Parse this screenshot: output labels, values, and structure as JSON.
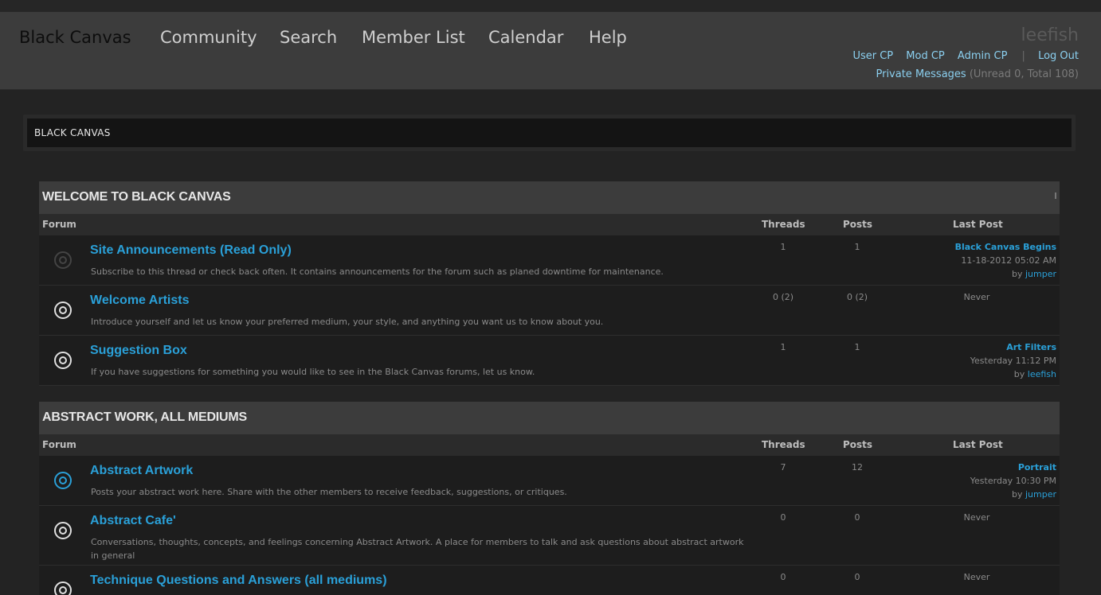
{
  "header": {
    "brand": "Black Canvas",
    "nav": [
      "Community",
      "Search",
      "Member List",
      "Calendar",
      "Help"
    ],
    "username": "leefish",
    "user_links": [
      "User CP",
      "Mod CP",
      "Admin CP",
      "Log Out"
    ],
    "pm_label": "Private Messages",
    "pm_count": "(Unread 0, Total 108)"
  },
  "breadcrumb": "BLACK CANVAS",
  "columns": {
    "forum": "Forum",
    "threads": "Threads",
    "posts": "Posts",
    "last_post": "Last Post"
  },
  "colors": {
    "accent": "#2aa0d8",
    "header_bg": "#3c3c3c",
    "row_bg": "#1d1d1d"
  },
  "categories": [
    {
      "title": "WELCOME TO BLACK CANVAS",
      "forums": [
        {
          "title": "Site Announcements (Read Only)",
          "desc": "Subscribe to this thread or check back often. It contains announcements for the forum such as planed downtime for maintenance.",
          "threads": "1",
          "posts": "1",
          "lp_title": "Black Canvas Begins",
          "lp_date": "11-18-2012 05:02 AM",
          "lp_by": "by",
          "lp_user": "jumper",
          "icon": "forum-off-icon"
        },
        {
          "title": "Welcome Artists",
          "desc": "Introduce yourself and let us know your preferred medium, your style, and anything you want us to know about you.",
          "threads": "0 (2)",
          "posts": "0 (2)",
          "never": "Never",
          "icon": "forum-read-icon"
        },
        {
          "title": "Suggestion Box",
          "desc": "If you have suggestions for something you would like to see in the Black Canvas forums, let us know.",
          "threads": "1",
          "posts": "1",
          "lp_title": "Art Filters",
          "lp_date": "Yesterday 11:12 PM",
          "lp_by": "by",
          "lp_user": "leefish",
          "icon": "forum-read-icon"
        }
      ]
    },
    {
      "title": "ABSTRACT WORK, ALL MEDIUMS",
      "forums": [
        {
          "title": "Abstract Artwork",
          "desc": "Posts your abstract work here. Share with the other members to receive feedback, suggestions, or critiques.",
          "threads": "7",
          "posts": "12",
          "lp_title": "Portrait",
          "lp_date": "Yesterday 10:30 PM",
          "lp_by": "by",
          "lp_user": "jumper",
          "icon": "forum-new-icon"
        },
        {
          "title": "Abstract Cafe'",
          "desc": "Conversations, thoughts, concepts, and feelings concerning Abstract Artwork. A place for members to talk and ask questions about abstract artwork in general",
          "threads": "0",
          "posts": "0",
          "never": "Never",
          "icon": "forum-read-icon"
        },
        {
          "title": "Technique Questions and Answers (all mediums)",
          "desc": "",
          "threads": "0",
          "posts": "0",
          "never": "Never",
          "icon": "forum-read-icon"
        }
      ]
    }
  ]
}
